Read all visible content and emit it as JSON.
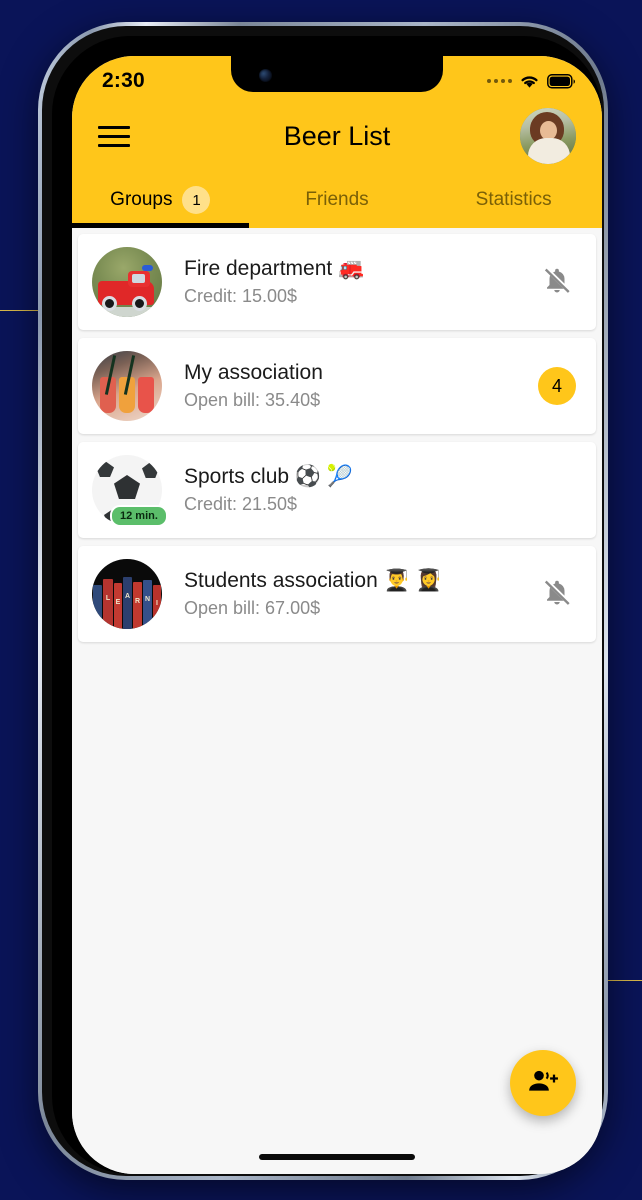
{
  "colors": {
    "brand_yellow": "#FFC61A",
    "badge_light_yellow": "#FFE08A",
    "page_background": "#0a1458",
    "list_background": "#f7f7f7",
    "card_background": "#ffffff",
    "subtitle_gray": "#8a8a8a",
    "online_green": "#5BBE6A"
  },
  "status_bar": {
    "time": "2:30",
    "signal_icon": "signal-dots-icon",
    "wifi_icon": "wifi-icon",
    "battery_icon": "battery-full-icon"
  },
  "app_bar": {
    "menu_icon": "hamburger-menu-icon",
    "title": "Beer List",
    "avatar_alt": "profile-avatar"
  },
  "tabs": {
    "active_index": 0,
    "items": [
      {
        "label": "Groups",
        "badge": "1"
      },
      {
        "label": "Friends",
        "badge": ""
      },
      {
        "label": "Statistics",
        "badge": ""
      }
    ]
  },
  "groups": [
    {
      "name": "Fire department 🚒",
      "balance_label": "Credit: 15.00$",
      "avatar": "fire-truck-photo",
      "trailing": "bell-off-icon",
      "badge_count": "",
      "time_badge": ""
    },
    {
      "name": "My association",
      "balance_label": "Open bill: 35.40$",
      "avatar": "cocktails-photo",
      "trailing": "count-badge",
      "badge_count": "4",
      "time_badge": ""
    },
    {
      "name": "Sports club ⚽ 🎾",
      "balance_label": "Credit: 21.50$",
      "avatar": "soccer-ball-photo",
      "trailing": "",
      "badge_count": "",
      "time_badge": "12 min."
    },
    {
      "name": "Students association 👨‍🎓 👩‍🎓",
      "balance_label": "Open bill: 67.00$",
      "avatar": "learning-books-photo",
      "trailing": "bell-off-icon",
      "badge_count": "",
      "time_badge": ""
    }
  ],
  "fab": {
    "icon": "person-add-icon",
    "label": ""
  },
  "home_indicator": {
    "label": ""
  }
}
